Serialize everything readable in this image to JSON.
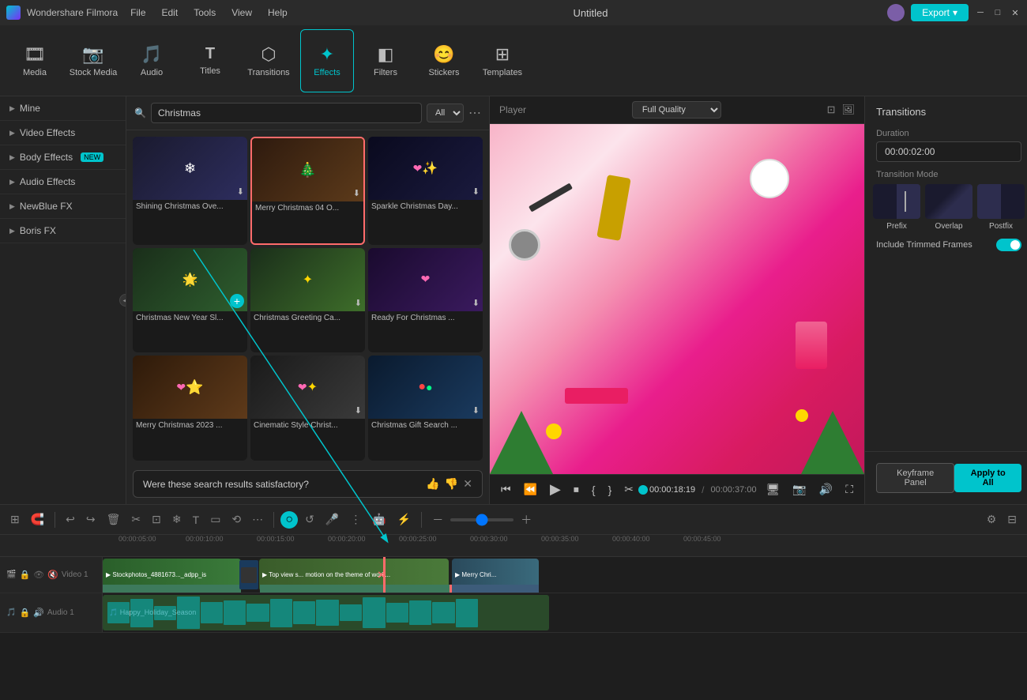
{
  "app": {
    "name": "Wondershare Filmora",
    "title": "Untitled"
  },
  "menu": [
    "File",
    "Edit",
    "Tools",
    "View",
    "Help"
  ],
  "toolbar": {
    "items": [
      {
        "id": "media",
        "label": "Media",
        "icon": "🎞"
      },
      {
        "id": "stock",
        "label": "Stock Media",
        "icon": "📷"
      },
      {
        "id": "audio",
        "label": "Audio",
        "icon": "🎵"
      },
      {
        "id": "titles",
        "label": "Titles",
        "icon": "T"
      },
      {
        "id": "transitions",
        "label": "Transitions",
        "icon": "⬡"
      },
      {
        "id": "effects",
        "label": "Effects",
        "icon": "✦",
        "active": true
      },
      {
        "id": "filters",
        "label": "Filters",
        "icon": "◧"
      },
      {
        "id": "stickers",
        "label": "Stickers",
        "icon": "😊"
      },
      {
        "id": "templates",
        "label": "Templates",
        "icon": "⊞"
      }
    ],
    "export_label": "Export"
  },
  "left_panel": {
    "items": [
      {
        "label": "Mine",
        "icon": "▶"
      },
      {
        "label": "Video Effects",
        "icon": "▶"
      },
      {
        "label": "Body Effects",
        "icon": "▶",
        "badge": "NEW"
      },
      {
        "label": "Audio Effects",
        "icon": "▶"
      },
      {
        "label": "NewBlue FX",
        "icon": "▶"
      },
      {
        "label": "Boris FX",
        "icon": "▶"
      }
    ]
  },
  "effects_panel": {
    "search_placeholder": "Christmas",
    "filter_label": "All",
    "effects": [
      {
        "label": "Shining Christmas Ove...",
        "has_download": true,
        "col": 1
      },
      {
        "label": "Merry Christmas 04 O...",
        "has_download": true,
        "col": 2,
        "selected": true
      },
      {
        "label": "Sparkle Christmas Day...",
        "has_download": true,
        "col": 3
      },
      {
        "label": "Christmas New Year Sl...",
        "has_download": false,
        "has_add": true,
        "col": 1
      },
      {
        "label": "Christmas Greeting Ca...",
        "has_download": true,
        "col": 2
      },
      {
        "label": "Ready For Christmas ...",
        "has_download": true,
        "has_heart": true,
        "col": 3
      },
      {
        "label": "Merry Christmas 2023 ...",
        "has_download": false,
        "col": 1,
        "has_heart": true
      },
      {
        "label": "Cinematic Style Christ...",
        "has_download": true,
        "col": 2,
        "has_heart": true
      },
      {
        "label": "Christmas Gift Search ...",
        "has_download": true,
        "col": 3
      }
    ],
    "feedback_text": "Were these search results satisfactory?",
    "feedback_yes": "👍",
    "feedback_no": "👎"
  },
  "player": {
    "label": "Player",
    "quality": "Full Quality",
    "time_current": "00:00:18:19",
    "time_separator": "/",
    "time_total": "00:00:37:00"
  },
  "transitions_panel": {
    "header": "Transitions",
    "duration_label": "Duration",
    "duration_value": "00:00:02:00",
    "mode_label": "Transition Mode",
    "modes": [
      {
        "label": "Prefix",
        "active": false
      },
      {
        "label": "Overlap",
        "active": false
      },
      {
        "label": "Postfix",
        "active": false
      }
    ],
    "include_frames_label": "Include Trimmed Frames",
    "keyframe_btn": "Keyframe Panel",
    "apply_all_btn": "Apply to All"
  },
  "timeline": {
    "ruler_marks": [
      "00:00:05:00",
      "00:00:10:00",
      "00:00:15:00",
      "00:00:20:00",
      "00:00:25:00",
      "00:00:30:00",
      "00:00:35:00",
      "00:00:40:00",
      "00:00:45:00"
    ],
    "tracks": [
      {
        "id": "video1",
        "name": "Video 1",
        "type": "video",
        "clips": [
          {
            "label": "▶ Stockphotos_48816731..adpp_is",
            "color": "#2a5f2a"
          },
          {
            "label": "▶ Top view s...",
            "color": "#1a3a5c"
          },
          {
            "label": "motion on the theme of work...",
            "color": "#3a5c2a"
          },
          {
            "label": "▶ Merry Chri...",
            "color": "#2a4a5c"
          }
        ]
      },
      {
        "id": "audio1",
        "name": "Audio 1",
        "type": "audio",
        "clips": [
          {
            "label": "🎵 Happy_Holiday_Season",
            "color": "#2a4a2a"
          }
        ]
      }
    ],
    "playhead_position": "355px"
  },
  "bottom_toolbar": {
    "zoom_label": "zoom"
  }
}
